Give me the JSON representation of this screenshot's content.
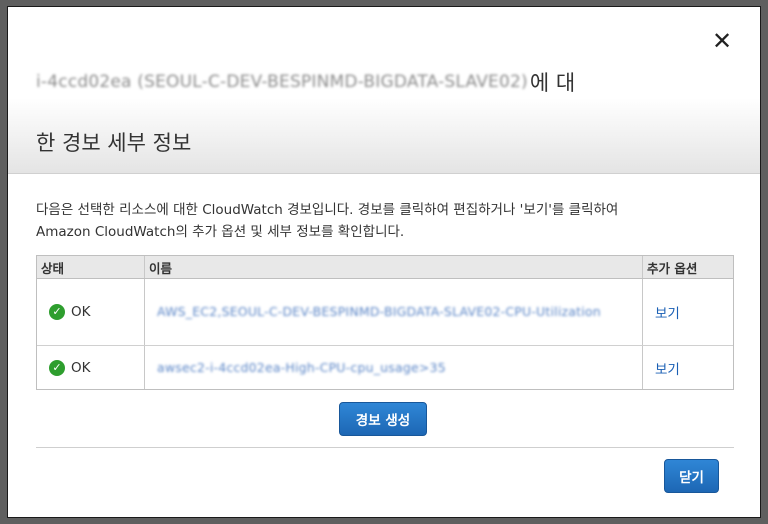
{
  "dialog": {
    "close_glyph": "✕",
    "title_blurred": "i-4ccd02ea (SEOUL-C-DEV-BESPINMD-BIGDATA-SLAVE02)",
    "title_suffix": "에 대",
    "title_line2": "한 경보 세부 정보",
    "description_line1": "다음은 선택한 리소스에 대한 CloudWatch 경보입니다. 경보를 클릭하여 편집하거나 '보기'를 클릭하여",
    "description_line2": "Amazon CloudWatch의 추가 옵션 및 세부 정보를 확인합니다."
  },
  "table": {
    "headers": {
      "status": "상태",
      "name": "이름",
      "options": "추가 옵션"
    },
    "rows": [
      {
        "status": "OK",
        "name": "AWS_EC2,SEOUL-C-DEV-BESPINMD-BIGDATA-SLAVE02-CPU-Utilization",
        "action": "보기"
      },
      {
        "status": "OK",
        "name": "awsec2-i-4ccd02ea-High-CPU-cpu_usage>35",
        "action": "보기"
      }
    ]
  },
  "buttons": {
    "create_alarm": "경보 생성",
    "close": "닫기"
  },
  "colors": {
    "button": "#2277c6",
    "ok_icon": "#2e9e2e",
    "link": "#1a5fb4"
  },
  "icons": {
    "close": "close-icon",
    "ok": "check-circle-icon"
  }
}
